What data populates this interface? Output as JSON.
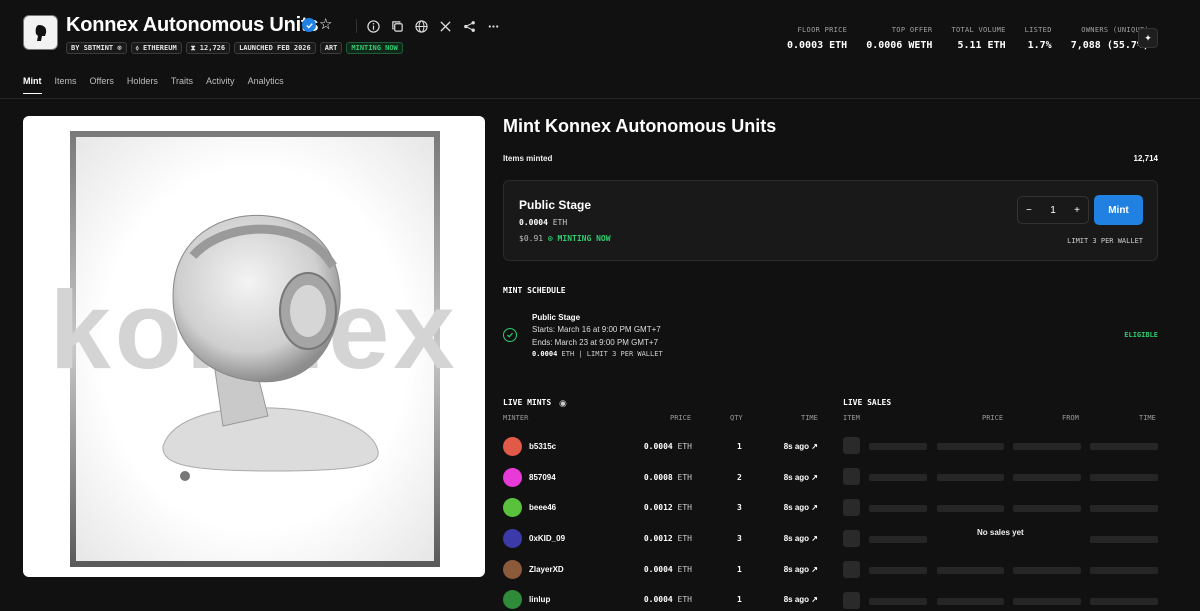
{
  "collection": {
    "title": "Konnex Autonomous Units",
    "tags": [
      {
        "label": "BY SBTMINT ⊙",
        "style": "normal"
      },
      {
        "label": "⬨ ETHEREUM",
        "style": "normal"
      },
      {
        "label": "⧗ 12,726",
        "style": "normal"
      },
      {
        "label": "LAUNCHED FEB 2026",
        "style": "normal"
      },
      {
        "label": "ART",
        "style": "normal"
      },
      {
        "label": "MINTING NOW",
        "style": "green"
      }
    ]
  },
  "header_icons": [
    "star-icon",
    "info-icon",
    "copy-icon",
    "globe-icon",
    "x-icon",
    "share-icon",
    "more-icon"
  ],
  "stats": [
    {
      "label": "FLOOR PRICE",
      "value": "0.0003 ETH"
    },
    {
      "label": "TOP OFFER",
      "value": "0.0006 WETH"
    },
    {
      "label": "TOTAL VOLUME",
      "value": "5.11 ETH"
    },
    {
      "label": "LISTED",
      "value": "1.7%"
    },
    {
      "label": "OWNERS (UNIQUE)",
      "value": "7,088 (55.7%)"
    }
  ],
  "tabs": [
    "Mint",
    "Items",
    "Offers",
    "Holders",
    "Traits",
    "Activity",
    "Analytics"
  ],
  "active_tab": "Mint",
  "artwork": {
    "watermark": "konnex"
  },
  "mint": {
    "title": "Mint Konnex Autonomous Units",
    "items_minted_label": "Items minted",
    "items_minted_value": "12,714",
    "stage": {
      "name": "Public Stage",
      "price": "0.0004",
      "unit": "ETH",
      "usd": "$0.91",
      "status": "⊙ MINTING NOW",
      "quantity": "1",
      "minus": "−",
      "plus": "+",
      "mint_label": "Mint",
      "limit": "LIMIT 3 PER WALLET"
    }
  },
  "schedule": {
    "title": "MINT SCHEDULE",
    "name": "Public Stage",
    "starts": "Starts: March 16 at 9:00 PM GMT+7",
    "ends": "Ends: March 23 at 9:00 PM GMT+7",
    "meta_price": "0.0004",
    "meta_rest": "ETH | LIMIT 3 PER WALLET",
    "eligibility": "ELIGIBLE"
  },
  "live_mints": {
    "title": "LIVE MINTS",
    "headers": {
      "minter": "MINTER",
      "price": "PRICE",
      "qty": "QTY",
      "time": "TIME"
    },
    "rows": [
      {
        "minter": "b5315c",
        "price": "0.0004",
        "unit": "ETH",
        "qty": "1",
        "time": "8s ago ↗",
        "color": "#e05a47"
      },
      {
        "minter": "857094",
        "price": "0.0008",
        "unit": "ETH",
        "qty": "2",
        "time": "8s ago ↗",
        "color": "#e83ad6"
      },
      {
        "minter": "beee46",
        "price": "0.0012",
        "unit": "ETH",
        "qty": "3",
        "time": "8s ago ↗",
        "color": "#59c13b"
      },
      {
        "minter": "0xKID_09",
        "price": "0.0012",
        "unit": "ETH",
        "qty": "3",
        "time": "8s ago ↗",
        "color": "#3b3aa8"
      },
      {
        "minter": "ZlayerXD",
        "price": "0.0004",
        "unit": "ETH",
        "qty": "1",
        "time": "8s ago ↗",
        "color": "#8a5a3a"
      },
      {
        "minter": "linlup",
        "price": "0.0004",
        "unit": "ETH",
        "qty": "1",
        "time": "8s ago ↗",
        "color": "#2f8a3a"
      }
    ]
  },
  "live_sales": {
    "title": "LIVE SALES",
    "headers": {
      "item": "ITEM",
      "price": "PRICE",
      "from": "FROM",
      "time": "TIME"
    },
    "empty_text": "No sales yet"
  },
  "colors": {
    "accent": "#2081e2",
    "success": "#2ecc71",
    "background": "#111111"
  }
}
